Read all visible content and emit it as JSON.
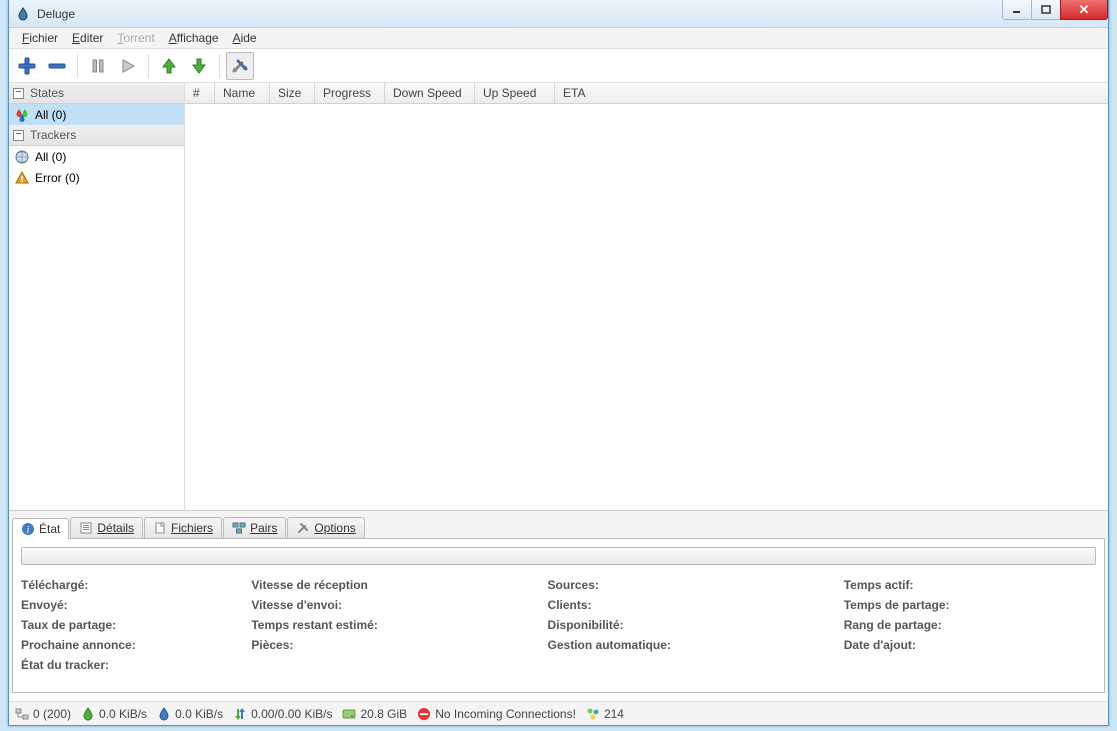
{
  "window": {
    "title": "Deluge"
  },
  "menu": {
    "file": "Fichier",
    "edit": "Editer",
    "torrent": "Torrent",
    "view": "Affichage",
    "help": "Aide"
  },
  "sidebar": {
    "states_header": "States",
    "states_all": "All (0)",
    "trackers_header": "Trackers",
    "trackers_all": "All (0)",
    "trackers_error": "Error (0)"
  },
  "columns": {
    "num": "#",
    "name": "Name",
    "size": "Size",
    "progress": "Progress",
    "down": "Down Speed",
    "up": "Up Speed",
    "eta": "ETA"
  },
  "tabs": {
    "status": "État",
    "details": "Détails",
    "files": "Fichiers",
    "peers": "Pairs",
    "options": "Options"
  },
  "detail_labels": {
    "downloaded": "Téléchargé:",
    "uploaded": "Envoyé:",
    "share_ratio": "Taux de partage:",
    "next_announce": "Prochaine annonce:",
    "tracker_status": "État du tracker:",
    "down_speed": "Vitesse de réception",
    "up_speed": "Vitesse d'envoi:",
    "eta": "Temps restant estimé:",
    "pieces": "Pièces:",
    "seeds": "Sources:",
    "peers": "Clients:",
    "availability": "Disponibilité:",
    "auto_managed": "Gestion automatique:",
    "active_time": "Temps actif:",
    "seeding_time": "Temps de partage:",
    "seed_rank": "Rang de partage:",
    "date_added": "Date d'ajout:"
  },
  "status": {
    "connections": "0 (200)",
    "down_rate": "0.0 KiB/s",
    "up_rate": "0.0 KiB/s",
    "protocol": "0.00/0.00 KiB/s",
    "disk": "20.8 GiB",
    "health": "No Incoming Connections!",
    "dht": "214"
  }
}
